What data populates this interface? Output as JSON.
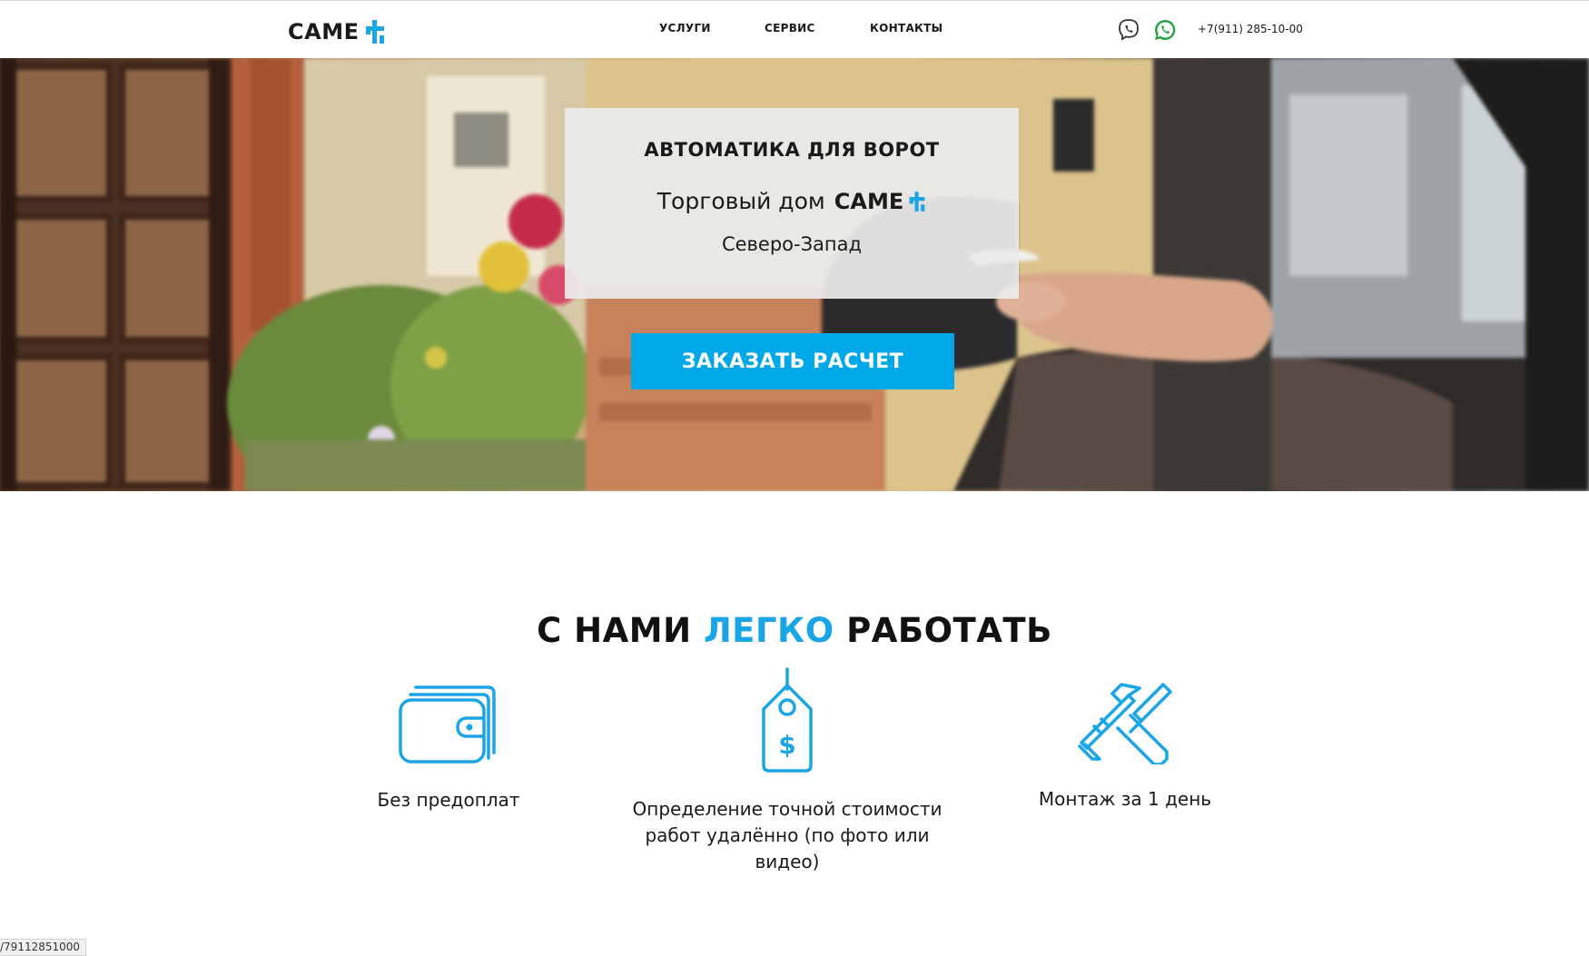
{
  "header": {
    "logo_text": "CAME",
    "nav": [
      {
        "label": "УСЛУГИ"
      },
      {
        "label": "СЕРВИС"
      },
      {
        "label": "КОНТАКТЫ"
      }
    ],
    "icons": [
      "viber-icon",
      "whatsapp-icon"
    ],
    "phone": "+7(911) 285-10-00"
  },
  "hero": {
    "title": "АВТОМАТИКА ДЛЯ ВОРОТ",
    "subtitle_prefix": "Торговый дом",
    "subtitle_brand": "CAME",
    "region": "Северо-Запад",
    "cta_label": "ЗАКАЗАТЬ РАСЧЕТ"
  },
  "benefits": {
    "title_part1": "С НАМИ",
    "title_accent": "ЛЕГКО",
    "title_part2": "РАБОТАТЬ",
    "items": [
      {
        "icon": "wallet-icon",
        "label": "Без предоплат"
      },
      {
        "icon": "price-tag-icon",
        "label": "Определение точной стоимости работ удалённо (по фото или видео)"
      },
      {
        "icon": "tools-icon",
        "label": "Монтаж за 1 день"
      }
    ]
  },
  "status_bar": {
    "url": "/79112851000"
  },
  "colors": {
    "accent": "#1aa6e6",
    "cta": "#00a8e8",
    "text": "#1a1a1a"
  }
}
